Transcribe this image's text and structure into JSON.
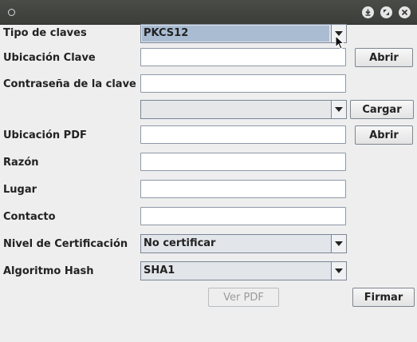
{
  "window": {
    "title": "",
    "controls": [
      "minimize-icon",
      "maximize-icon",
      "close-icon"
    ]
  },
  "form": {
    "key_type": {
      "label": "Tipo de claves",
      "value": "PKCS12"
    },
    "key_location": {
      "label": "Ubicación Clave",
      "value": "",
      "button": "Abrir"
    },
    "key_password": {
      "label": "Contraseña de la clave",
      "value": ""
    },
    "key_alias": {
      "value": "",
      "button": "Cargar"
    },
    "pdf_location": {
      "label": "Ubicación PDF",
      "value": "",
      "button": "Abrir"
    },
    "reason": {
      "label": "Razón",
      "value": ""
    },
    "place": {
      "label": "Lugar",
      "value": ""
    },
    "contact": {
      "label": "Contacto",
      "value": ""
    },
    "cert_level": {
      "label": "Nivel de Certificación",
      "value": "No certificar"
    },
    "hash_algorithm": {
      "label": "Algoritmo Hash",
      "value": "SHA1"
    }
  },
  "actions": {
    "view_pdf": "Ver PDF",
    "sign": "Firmar"
  },
  "colors": {
    "titlebar": "#3e403c",
    "background": "#eeeeee",
    "selection": "#a9bcd2",
    "border": "#7a8698"
  }
}
